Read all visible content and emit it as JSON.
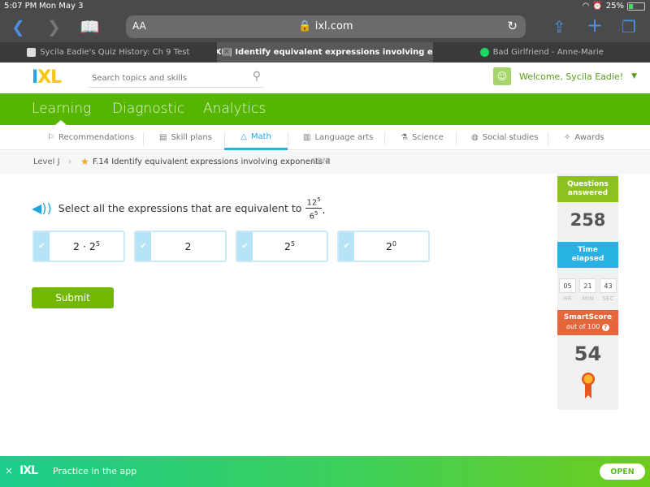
{
  "status_bar": {
    "time": "5:07 PM",
    "date": "Mon May 3",
    "battery": "25%",
    "battery_level": 0.25
  },
  "browser": {
    "aa_label": "AA",
    "url": "ixl.com",
    "tabs": [
      {
        "title": "Sycila Eadie's Quiz History: Ch 9 Test",
        "active": false
      },
      {
        "title": "IXL | Identify equivalent expressions involving e...",
        "active": true
      },
      {
        "title": "Bad Girlfriend - Anne-Marie",
        "active": false
      }
    ]
  },
  "header": {
    "logo": {
      "i": "I",
      "x": "X",
      "l": "L"
    },
    "search_placeholder": "Search topics and skills",
    "welcome": "Welcome, Sycila Eadie!"
  },
  "main_nav": [
    {
      "label": "Learning",
      "active": true
    },
    {
      "label": "Diagnostic",
      "active": false
    },
    {
      "label": "Analytics",
      "active": false
    }
  ],
  "subject_nav": [
    {
      "label": "Recommendations",
      "icon": "signpost-icon"
    },
    {
      "label": "Skill plans",
      "icon": "clipboard-icon"
    },
    {
      "label": "Math",
      "icon": "pyramid-icon",
      "active": true
    },
    {
      "label": "Language arts",
      "icon": "book-icon"
    },
    {
      "label": "Science",
      "icon": "flask-icon"
    },
    {
      "label": "Social studies",
      "icon": "globe-icon"
    },
    {
      "label": "Awards",
      "icon": "award-icon"
    }
  ],
  "breadcrumb": {
    "level": "Level J",
    "skill": "F.14 Identify equivalent expressions involving exponents II",
    "code": "QDM"
  },
  "question": {
    "prompt": "Select all the expressions that are equivalent to",
    "fraction": {
      "num_base": "12",
      "num_exp": "5",
      "den_base": "6",
      "den_exp": "5"
    },
    "end": "."
  },
  "answers": [
    {
      "base": "2 · 2",
      "exp": "5"
    },
    {
      "base": "2",
      "exp": ""
    },
    {
      "base": "2",
      "exp": "5"
    },
    {
      "base": "2",
      "exp": "0"
    }
  ],
  "submit_label": "Submit",
  "sidebar": {
    "questions_label_1": "Questions",
    "questions_label_2": "answered",
    "questions_answered": "258",
    "time_label_1": "Time",
    "time_label_2": "elapsed",
    "timer": [
      {
        "value": "05",
        "unit": "HR"
      },
      {
        "value": "21",
        "unit": "MIN"
      },
      {
        "value": "43",
        "unit": "SEC"
      }
    ],
    "smartscore_label": "SmartScore",
    "smartscore_sub": "out of 100",
    "smartscore": "54"
  },
  "banner": {
    "close": "×",
    "logo": "IXL",
    "text": "Practice in the app",
    "open_label": "OPEN"
  }
}
